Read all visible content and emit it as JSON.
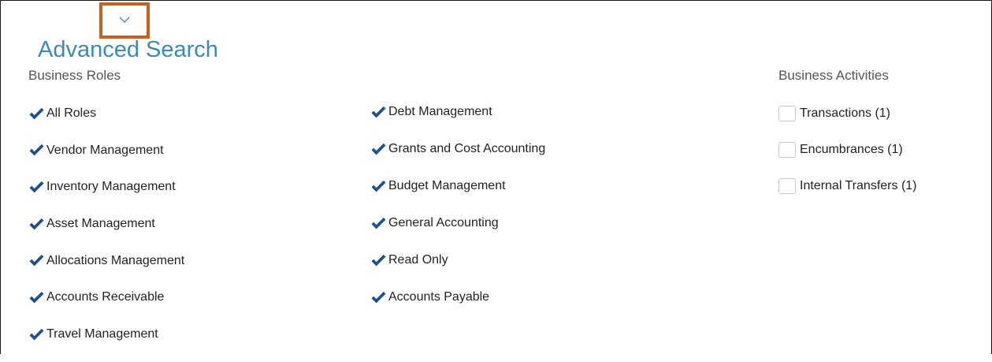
{
  "advanced_search": {
    "title": "Advanced Search",
    "toggle_icon": "chevron-down-icon",
    "toggle_highlight_color": "#c5611c",
    "title_color": "#3d8bb3",
    "check_color": "#1f4f8f"
  },
  "business_roles": {
    "heading": "Business Roles",
    "column_1": [
      {
        "label": "All Roles",
        "checked": true
      },
      {
        "label": "Vendor Management",
        "checked": true
      },
      {
        "label": "Inventory Management",
        "checked": true
      },
      {
        "label": "Asset Management",
        "checked": true
      },
      {
        "label": "Allocations Management",
        "checked": true
      },
      {
        "label": "Accounts Receivable",
        "checked": true
      },
      {
        "label": "Travel Management",
        "checked": true
      }
    ],
    "column_2": [
      {
        "label": "Debt Management",
        "checked": true
      },
      {
        "label": "Grants and Cost Accounting",
        "checked": true
      },
      {
        "label": "Budget Management",
        "checked": true
      },
      {
        "label": "General Accounting",
        "checked": true
      },
      {
        "label": "Read Only",
        "checked": true
      },
      {
        "label": "Accounts Payable",
        "checked": true
      }
    ]
  },
  "business_activities": {
    "heading": "Business Activities",
    "items": [
      {
        "label": "Transactions (1)",
        "checked": false
      },
      {
        "label": "Encumbrances (1)",
        "checked": false
      },
      {
        "label": "Internal Transfers (1)",
        "checked": false
      }
    ]
  }
}
